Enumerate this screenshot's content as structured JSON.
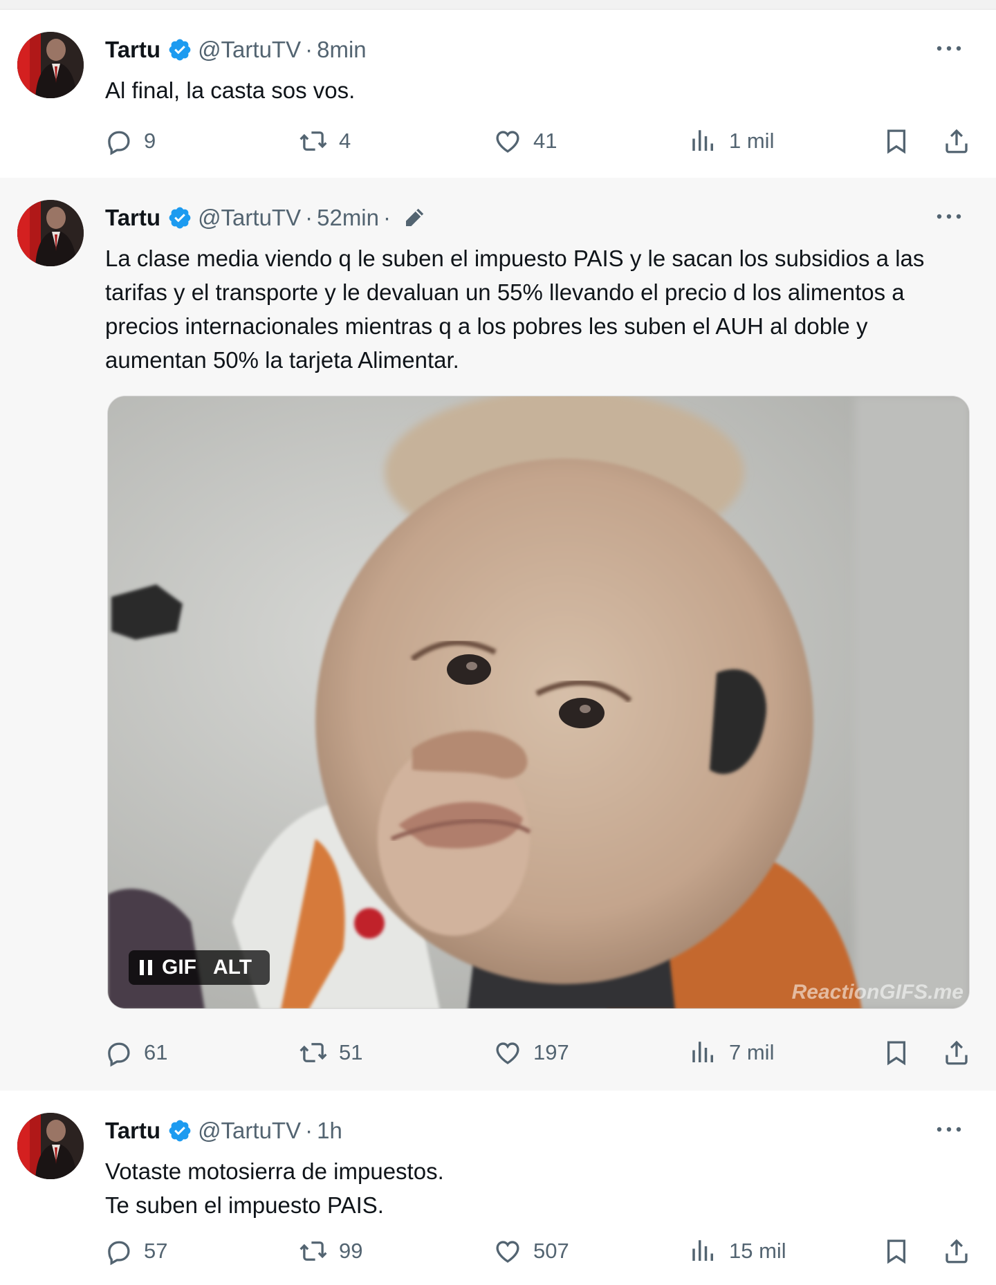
{
  "colors": {
    "verified": "#1d9bf0",
    "muted": "#536471",
    "text": "#0f1419"
  },
  "tweets": [
    {
      "name": "Tartu",
      "handle": "@TartuTV",
      "separator": "·",
      "time": "8min",
      "edited": false,
      "text": [
        "Al final, la casta sos vos."
      ],
      "replies": "9",
      "retweets": "4",
      "likes": "41",
      "views": "1 mil"
    },
    {
      "name": "Tartu",
      "handle": "@TartuTV",
      "separator": "·",
      "time": "52min",
      "separator2": "·",
      "edited": true,
      "text": [
        "La clase media viendo q le suben el impuesto PAIS y le sacan los subsidios a las tarifas y el transporte y le devaluan un 55% llevando el precio d los alimentos a precios internacionales mientras q a los pobres les suben el AUH al doble y aumentan 50% la tarjeta Alimentar."
      ],
      "media": {
        "badge_gif": "GIF",
        "badge_alt": "ALT",
        "watermark": "ReactionGIFS.me"
      },
      "replies": "61",
      "retweets": "51",
      "likes": "197",
      "views": "7 mil"
    },
    {
      "name": "Tartu",
      "handle": "@TartuTV",
      "separator": "·",
      "time": "1h",
      "edited": false,
      "text": [
        "Votaste motosierra de impuestos.",
        "Te suben el impuesto PAIS."
      ],
      "replies": "57",
      "retweets": "99",
      "likes": "507",
      "views": "15 mil"
    }
  ]
}
